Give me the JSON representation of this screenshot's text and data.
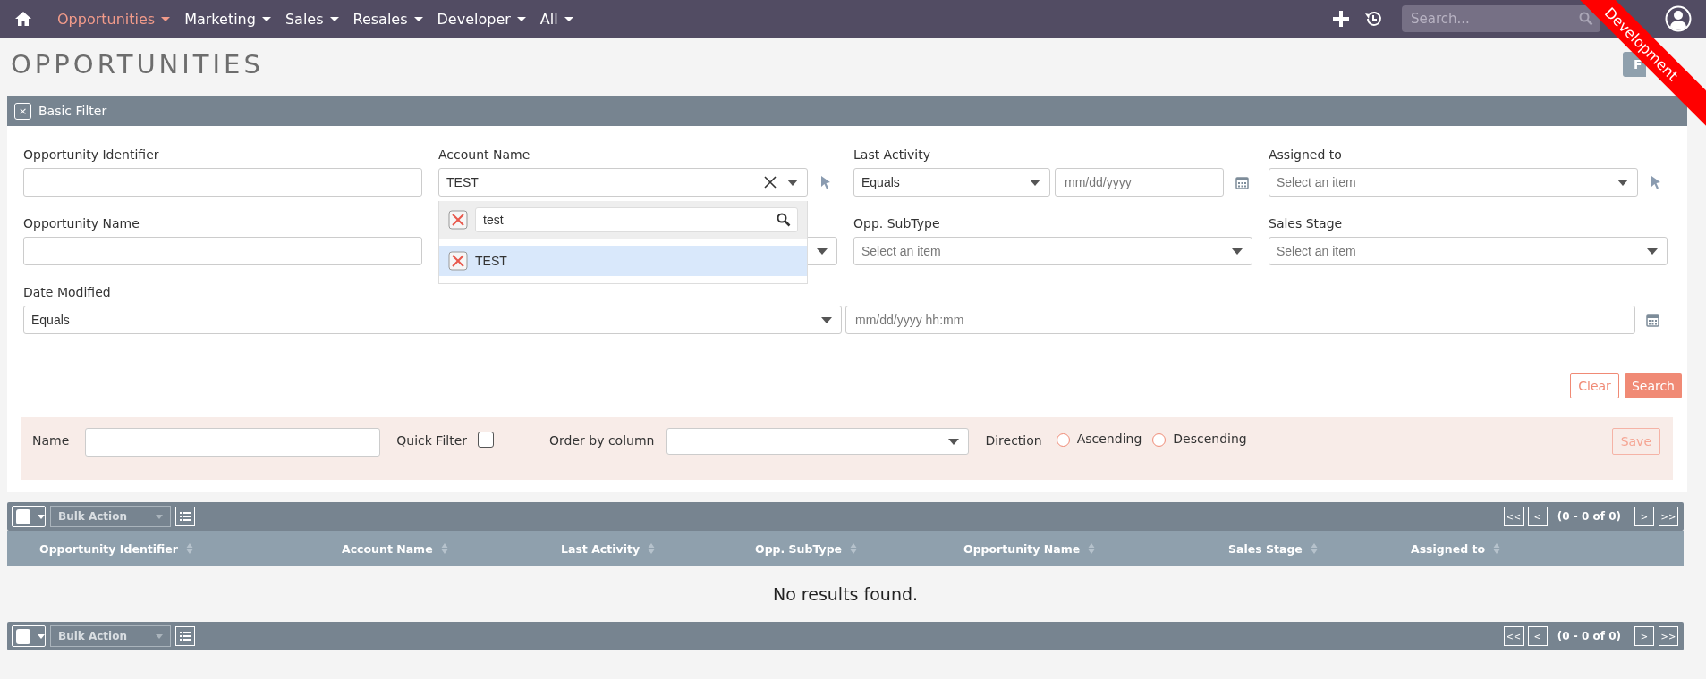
{
  "nav": {
    "items": [
      {
        "label": "Opportunities",
        "selected": true
      },
      {
        "label": "Marketing",
        "selected": false
      },
      {
        "label": "Sales",
        "selected": false
      },
      {
        "label": "Resales",
        "selected": false
      },
      {
        "label": "Developer",
        "selected": false
      },
      {
        "label": "All",
        "selected": false
      }
    ],
    "search": {
      "placeholder": "Search..."
    }
  },
  "ribbon": "Development",
  "page_title": "OPPORTUNITIES",
  "header_button": "F",
  "filter": {
    "title": "Basic Filter",
    "close": "×",
    "rows": [
      [
        {
          "kind": "text",
          "label": "Opportunity Identifier"
        },
        {
          "kind": "select",
          "label": "Account Name",
          "value": "TEST",
          "clearable": true,
          "picker": true,
          "dropdown": {
            "search": "test",
            "options": [
              {
                "label": "TEST",
                "selected": true
              }
            ]
          }
        },
        {
          "kind": "daterange",
          "label": "Last Activity",
          "operator": "Equals",
          "placeholder": "mm/dd/yyyy"
        },
        {
          "kind": "select",
          "label": "Assigned to",
          "placeholder": "Select an item",
          "picker": true
        }
      ],
      [
        {
          "kind": "text",
          "label": "Opportunity Name"
        },
        {
          "kind": "select"
        },
        {
          "kind": "select",
          "label": "Opp. SubType",
          "placeholder": "Select an item"
        },
        {
          "kind": "select",
          "label": "Sales Stage",
          "placeholder": "Select an item"
        }
      ],
      [
        {
          "kind": "datewide",
          "label": "Date Modified",
          "operator": "Equals",
          "placeholder": "mm/dd/yyyy hh:mm"
        }
      ]
    ],
    "buttons": {
      "clear": "Clear",
      "search": "Search"
    }
  },
  "save_panel": {
    "name_label": "Name",
    "quick_filter": {
      "label": "Quick Filter",
      "checked": false
    },
    "order_label": "Order by column",
    "direction_label": "Direction",
    "directions": [
      {
        "label": "Ascending",
        "selected": false
      },
      {
        "label": "Descending",
        "selected": false
      }
    ],
    "save": "Save"
  },
  "table": {
    "toolbars": [
      {
        "select_all_checked": false,
        "bulk_action": "Bulk Action",
        "pagination": "(0 - 0 of 0)",
        "page_buttons": [
          "<<",
          "<",
          ">",
          ">>"
        ]
      },
      {
        "select_all_checked": false,
        "bulk_action": "Bulk Action",
        "pagination": "(0 - 0 of 0)",
        "page_buttons": [
          "<<",
          "<",
          ">",
          ">>"
        ]
      }
    ],
    "columns": [
      "Opportunity Identifier",
      "Account Name",
      "Last Activity",
      "Opp. SubType",
      "Opportunity Name",
      "Sales Stage",
      "Assigned to"
    ],
    "empty": "No results found."
  }
}
